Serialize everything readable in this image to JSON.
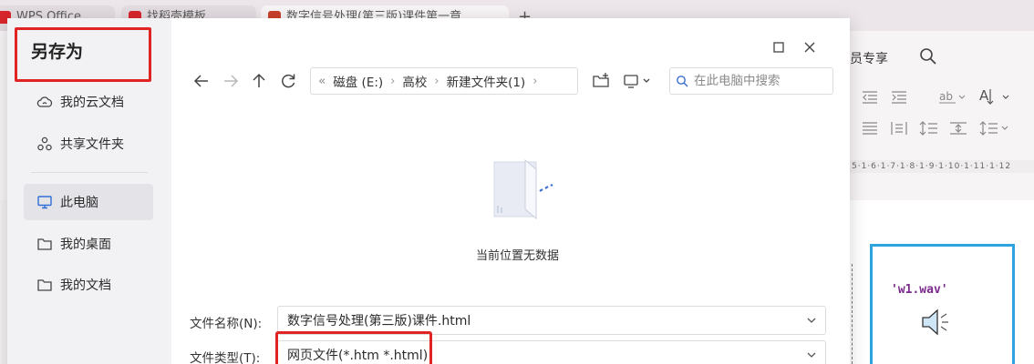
{
  "background_app": {
    "tabs": [
      {
        "label": "WPS Office",
        "logo_color": "#d8262c"
      },
      {
        "label": "找稻壳模板",
        "logo_color": "#d8262c"
      },
      {
        "label": "数字信号处理(第三版)课件第一章",
        "logo_color": "#c9402b"
      }
    ],
    "new_tab": "+",
    "member_label": "员专享",
    "ruler_text": "5·1·6·1·7·1·8·1·9·1·10·1·11·1·12",
    "media_filename": "'w1.wav'",
    "media_border_color": "#2fa3e0"
  },
  "dialog": {
    "title": "另存为",
    "highlight_color": "#e02424",
    "sidebar": {
      "items": [
        {
          "label": "我的云文档",
          "icon": "cloud-icon"
        },
        {
          "label": "共享文件夹",
          "icon": "share-icon"
        },
        {
          "label": "此电脑",
          "icon": "computer-icon",
          "active": true
        },
        {
          "label": "我的桌面",
          "icon": "folder-icon"
        },
        {
          "label": "我的文档",
          "icon": "folder-icon"
        }
      ]
    },
    "breadcrumb": {
      "lead": "«",
      "items": [
        "磁盘 (E:)",
        "高校",
        "新建文件夹(1)"
      ],
      "separator": "›"
    },
    "search_placeholder": "在此电脑中搜索",
    "empty_message": "当前位置无数据",
    "filename": {
      "label": "文件名称(N):",
      "value": "数字信号处理(第三版)课件.html"
    },
    "filetype": {
      "label": "文件类型(T):",
      "value": "网页文件(*.htm *.html)"
    }
  }
}
